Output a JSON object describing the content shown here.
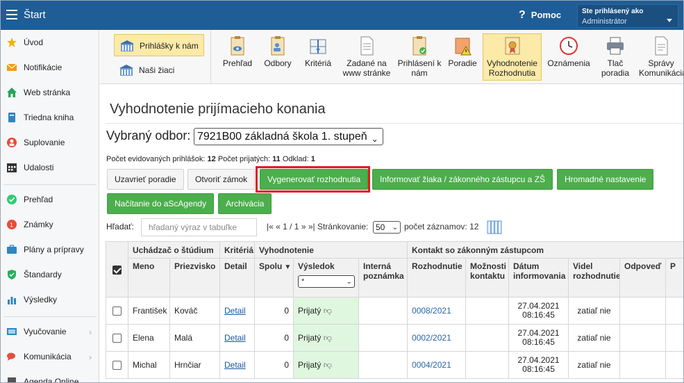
{
  "header": {
    "title": "Štart",
    "help_label": "Pomoc",
    "user_caption": "Ste prihlásený ako",
    "user_name": "Administrátor"
  },
  "sidebar": {
    "items": [
      {
        "label": "Úvod",
        "icon": "star-icon"
      },
      {
        "label": "Notifikácie",
        "icon": "envelope-icon"
      },
      {
        "label": "Web stránka",
        "icon": "home-icon"
      },
      {
        "label": "Triedna kniha",
        "icon": "book-icon"
      },
      {
        "label": "Suplovanie",
        "icon": "substitute-icon"
      },
      {
        "label": "Udalosti",
        "icon": "calendar-icon"
      },
      {
        "label": "Prehľad",
        "icon": "check-circle-icon"
      },
      {
        "label": "Známky",
        "icon": "grades-icon"
      },
      {
        "label": "Plány a prípravy",
        "icon": "briefcase-icon"
      },
      {
        "label": "Štandardy",
        "icon": "shield-icon"
      },
      {
        "label": "Výsledky",
        "icon": "bar-chart-icon"
      },
      {
        "label": "Vyučovanie",
        "icon": "teaching-icon"
      },
      {
        "label": "Komunikácia",
        "icon": "chat-icon"
      },
      {
        "label": "Agenda Online",
        "icon": "agenda-icon"
      }
    ]
  },
  "toolbar": {
    "left_buttons": [
      {
        "label": "Prihlášky k nám",
        "icon": "school-building-icon"
      },
      {
        "label": "Naši žiaci",
        "icon": "school-building-icon"
      }
    ],
    "tools": [
      {
        "label": "Prehľad",
        "icon": "clipboard-eye-icon"
      },
      {
        "label": "Odbory",
        "icon": "clipboard-person-icon"
      },
      {
        "label": "Kritériá",
        "icon": "scale-icon"
      },
      {
        "label": "Zadané na www stránke",
        "icon": "document-icon"
      },
      {
        "label": "Prihlásení k nám",
        "icon": "clipboard-check-icon"
      },
      {
        "label": "Poradie",
        "icon": "warning-document-icon"
      },
      {
        "label": "Vyhodnotenie Rozhodnutia",
        "icon": "certificate-icon"
      },
      {
        "label": "Oznámenia",
        "icon": "clock-icon"
      },
      {
        "label": "Tlač poradia",
        "icon": "printer-icon"
      },
      {
        "label": "Správy Komunikácia",
        "icon": "message-document-icon"
      }
    ]
  },
  "main": {
    "title": "Vyhodnotenie prijímacieho konania",
    "branch_label": "Vybraný odbor:",
    "branch_value": "7921B00 základná škola 1. stupeň",
    "counts": {
      "applications_label": "Počet evidovaných prihlášok:",
      "applications": "12",
      "accepted_label": "Počet prijatých:",
      "accepted": "11",
      "withdrawn_label": "Odklad:",
      "withdrawn": "1"
    },
    "actions_row1": [
      "Uzavrieť poradie",
      "Otvoriť zámok",
      "Vygenerovať rozhodnutia",
      "Informovať žiaka / zákonného zástupcu a ZŠ",
      "Hromadné nastavenie"
    ],
    "actions_row2": [
      "Načítanie do aScAgendy",
      "Archivácia"
    ],
    "search": {
      "label": "Hľadať:",
      "placeholder": "hľadaný výraz v tabuľke"
    },
    "pager": {
      "nav": "|« « 1 / 1 » »|",
      "page_size_label": "Stránkovanie:",
      "page_size": "50",
      "records_label": "počet záznamov:",
      "records": "12"
    }
  },
  "table": {
    "groups": [
      "Uchádzač o štúdium",
      "Kritériá",
      "Vyhodnotenie",
      "Kontakt so zákonným zástupcom"
    ],
    "columns": [
      "Meno",
      "Priezvisko",
      "Detail",
      "Spolu",
      "Výsledok",
      "Interná poznámka",
      "Rozhodnutie",
      "Možnosti kontaktu",
      "Dátum informovania",
      "Videl rozhodnutie",
      "Odpoveď",
      "P"
    ],
    "result_filter": "*",
    "rows": [
      {
        "first": "František",
        "last": "Kováč",
        "detail": "Detail",
        "total": "0",
        "result": "Prijatý",
        "decision": "0008/2021",
        "date": "27.04.2021",
        "time": "08:16:45",
        "seen": "zatiaľ nie"
      },
      {
        "first": "Elena",
        "last": "Malá",
        "detail": "Detail",
        "total": "0",
        "result": "Prijatý",
        "decision": "0002/2021",
        "date": "27.04.2021",
        "time": "08:16:45",
        "seen": "zatiaľ nie"
      },
      {
        "first": "Michal",
        "last": "Hrnčiar",
        "detail": "Detail",
        "total": "0",
        "result": "Prijatý",
        "decision": "0004/2021",
        "date": "27.04.2021",
        "time": "08:16:45",
        "seen": "zatiaľ nie"
      }
    ]
  },
  "colors": {
    "topbar": "#1f5d96",
    "green_button": "#4cae4c",
    "highlight": "#e01c1c",
    "accepted_cell": "#dff7df",
    "active_tool": "#fbeaa8"
  }
}
